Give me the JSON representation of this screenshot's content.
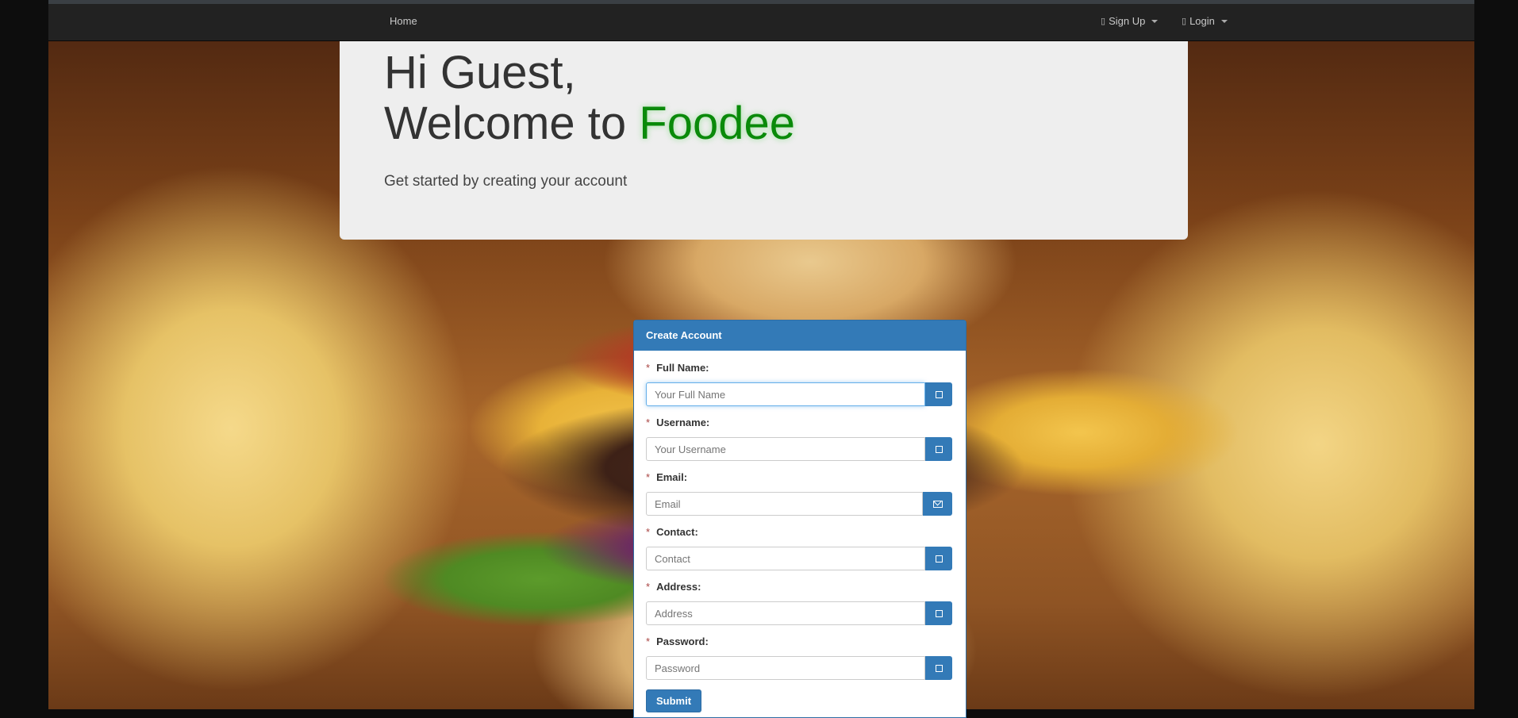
{
  "navbar": {
    "home": "Home",
    "signup": "Sign Up",
    "login": "Login",
    "signup_icon": "user-plus-icon",
    "login_icon": "login-icon"
  },
  "hero": {
    "greeting": "Hi Guest,",
    "welcome": "Welcome to ",
    "brand": "Foodee",
    "subtitle": "Get started by creating your account"
  },
  "form": {
    "title": "Create Account",
    "required_mark": "*",
    "fields": [
      {
        "label": "Full Name:",
        "placeholder": "Your Full Name",
        "icon": "user-icon"
      },
      {
        "label": "Username:",
        "placeholder": "Your Username",
        "icon": "user-icon"
      },
      {
        "label": "Email:",
        "placeholder": "Email",
        "icon": "envelope-icon"
      },
      {
        "label": "Contact:",
        "placeholder": "Contact",
        "icon": "phone-icon"
      },
      {
        "label": "Address:",
        "placeholder": "Address",
        "icon": "home-icon"
      },
      {
        "label": "Password:",
        "placeholder": "Password",
        "icon": "lock-icon"
      }
    ],
    "submit": "Submit"
  },
  "colors": {
    "navbar_bg": "#222222",
    "primary": "#337ab7",
    "brand_green": "#0a8a0a",
    "jumbotron_bg": "#eeeeee"
  }
}
